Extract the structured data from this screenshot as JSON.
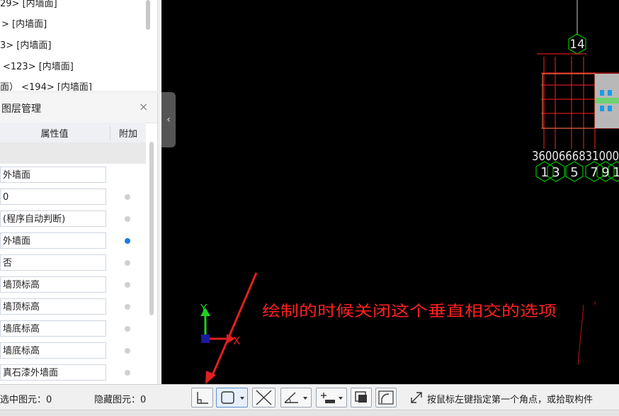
{
  "top_list": {
    "rows": [
      "29> [内墙面]",
      "> [内墙面]",
      "3> [内墙面]",
      "<123> [内墙面]",
      "面） <194> [内墙面]"
    ]
  },
  "layer_panel": {
    "title": "图层管理",
    "close": "×",
    "col_value": "属性值",
    "col_extra": "附加",
    "rows": [
      {
        "value": "外墙面",
        "radio": "none"
      },
      {
        "value": "0",
        "radio": "off"
      },
      {
        "value": "(程序自动判断)",
        "radio": "off"
      },
      {
        "value": "外墙面",
        "radio": "on"
      },
      {
        "value": "否",
        "radio": "off"
      },
      {
        "value": "墙顶标高",
        "radio": "off"
      },
      {
        "value": "墙顶标高",
        "radio": "off"
      },
      {
        "value": "墙底标高",
        "radio": "off"
      },
      {
        "value": "墙底标高",
        "radio": "off"
      },
      {
        "value": "真石漆外墙面",
        "radio": "off"
      }
    ]
  },
  "collapse_glyph": "‹",
  "canvas": {
    "axis_label_top": "14",
    "dims": "3600666831000",
    "axis_labels_bottom": [
      "1",
      "3",
      "5",
      "7",
      "9",
      "1"
    ],
    "annotation": "绘制的时候关闭这个垂直相交的选项",
    "axis_y": "Y",
    "axis_x": "X",
    "colors": {
      "grid": "#ff2020",
      "hex": "#00c000",
      "annotation": "#ff2020",
      "arrow": "#e02020"
    }
  },
  "statusbar": {
    "selected": "选中图元：0",
    "hidden": "隐藏图元：0",
    "hint": "按鼠标左键指定第一个角点，或拾取构件",
    "tools": [
      "perpendicular-snap-icon",
      "rectangle-draw-icon",
      "cross-intersect-icon",
      "angle-icon",
      "offset-point-icon",
      "screen-capture-icon",
      "arc-edit-icon"
    ]
  }
}
